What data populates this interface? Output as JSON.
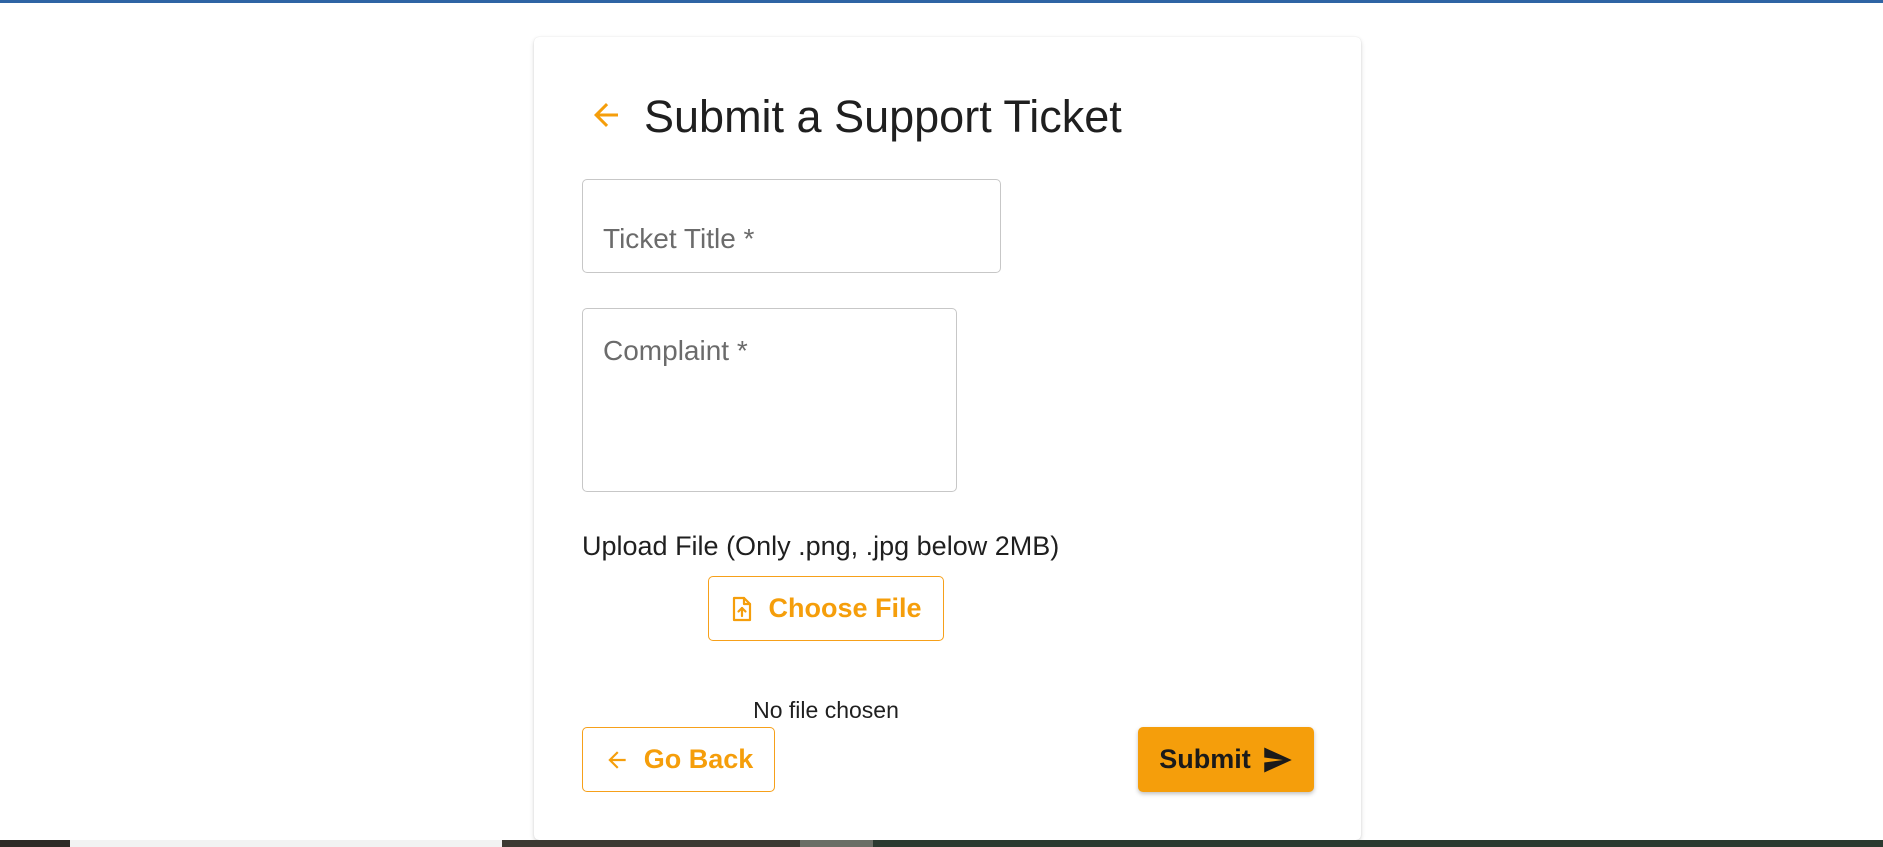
{
  "form": {
    "title": "Submit a Support Ticket",
    "ticket_title_placeholder": "Ticket Title *",
    "complaint_placeholder": "Complaint *",
    "upload_label": "Upload File (Only .png, .jpg below 2MB)",
    "choose_file_label": "Choose File",
    "file_status": "No file chosen",
    "go_back_label": "Go Back",
    "submit_label": "Submit"
  },
  "icons": {
    "header_back": "arrow-left-icon",
    "upload": "file-upload-icon",
    "go_back": "arrow-left-icon",
    "submit": "send-icon"
  },
  "colors": {
    "accent": "#f59e0b",
    "top_bar": "#2f64a4",
    "text": "#1f1f1f"
  }
}
